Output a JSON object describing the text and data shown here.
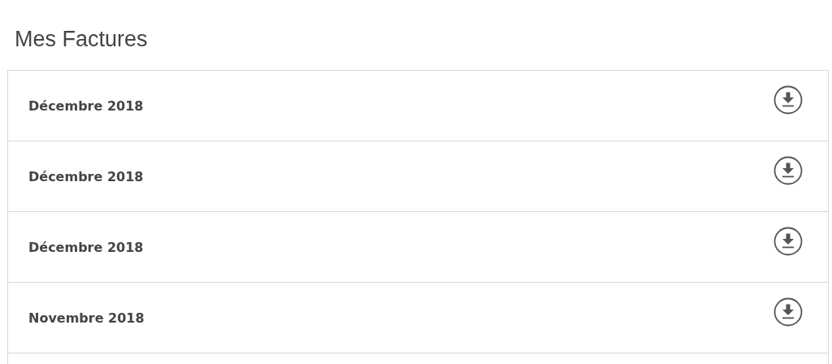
{
  "title": "Mes Factures",
  "invoices": [
    {
      "label": "Décembre 2018"
    },
    {
      "label": "Décembre 2018"
    },
    {
      "label": "Décembre 2018"
    },
    {
      "label": "Novembre 2018"
    }
  ]
}
